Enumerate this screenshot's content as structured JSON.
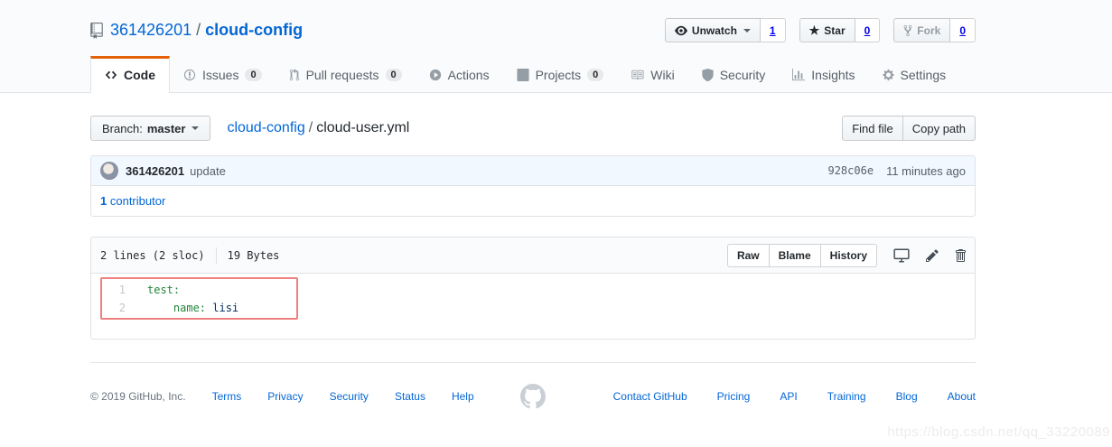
{
  "repo_header": {
    "owner": "361426201",
    "separator": "/",
    "name": "cloud-config",
    "watch": {
      "label": "Unwatch",
      "count": "1"
    },
    "star": {
      "label": "Star",
      "count": "0"
    },
    "fork": {
      "label": "Fork",
      "count": "0"
    }
  },
  "nav_tabs": [
    {
      "label": "Code"
    },
    {
      "label": "Issues",
      "count": "0"
    },
    {
      "label": "Pull requests",
      "count": "0"
    },
    {
      "label": "Actions"
    },
    {
      "label": "Projects",
      "count": "0"
    },
    {
      "label": "Wiki"
    },
    {
      "label": "Security"
    },
    {
      "label": "Insights"
    },
    {
      "label": "Settings"
    }
  ],
  "file_nav": {
    "branch_button": {
      "prefix": "Branch:",
      "branch": "master"
    },
    "breadcrumb": {
      "repo": "cloud-config",
      "separator": "/",
      "file": "cloud-user.yml"
    },
    "find_file": "Find file",
    "copy_path": "Copy path"
  },
  "commit_box": {
    "author": "361426201",
    "message": "update",
    "sha": "928c06e",
    "time": "11 minutes ago",
    "contributors": {
      "count": "1",
      "label": "contributor"
    }
  },
  "file_box": {
    "lines_info": "2 lines (2 sloc)",
    "size_info": "19 Bytes",
    "buttons": [
      "Raw",
      "Blame",
      "History"
    ],
    "code_lines": [
      {
        "num": "1",
        "key": "test:",
        "value": ""
      },
      {
        "num": "2",
        "key": "    name:",
        "value": " lisi"
      }
    ]
  },
  "footer": {
    "copyright": "© 2019 GitHub, Inc.",
    "left_links": [
      "Terms",
      "Privacy",
      "Security",
      "Status",
      "Help"
    ],
    "right_links": [
      "Contact GitHub",
      "Pricing",
      "API",
      "Training",
      "Blog",
      "About"
    ]
  },
  "icons": {
    "repo": "book-bookmark",
    "unwatch": "eye",
    "star": "star",
    "fork": "repo-fork",
    "code_tab": "angle-brackets",
    "issues_tab": "issue-opened-circle",
    "pull_requests_tab": "git-pull-request",
    "actions_tab": "play-circle",
    "projects_tab": "project-board",
    "wiki_tab": "book",
    "security_tab": "shield",
    "insights_tab": "bar-graph",
    "settings_tab": "gear",
    "desktop": "monitor",
    "edit": "pencil",
    "delete": "trash",
    "github_logo": "octocat-mark"
  },
  "colors": {
    "link_blue": "#0366d6",
    "active_tab_orange": "#e36209",
    "commit_tease_bg": "#f1f8ff",
    "yaml_key_green": "#22863a",
    "yaml_value_navy": "#032f62",
    "annotation_red": "#f08080"
  },
  "watermark": "https://blog.csdn.net/qq_33220089"
}
